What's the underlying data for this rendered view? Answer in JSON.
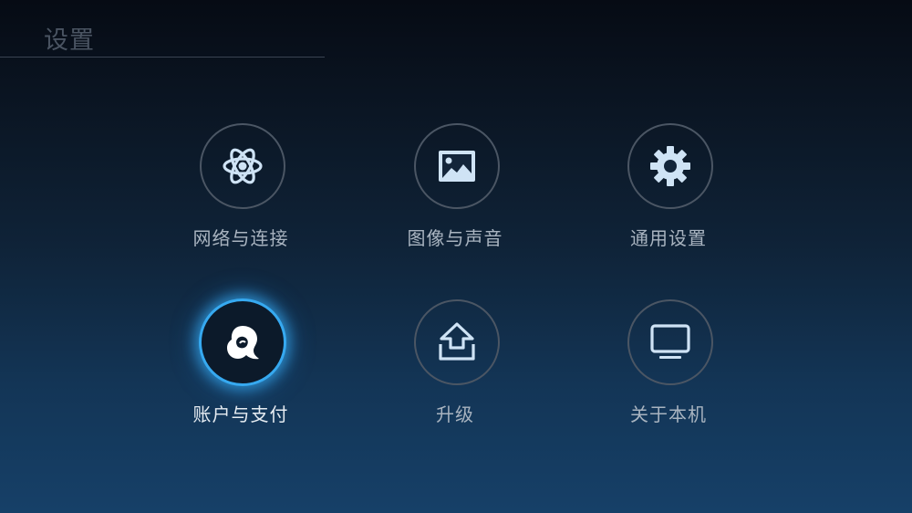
{
  "header": {
    "title": "设置"
  },
  "menu": {
    "items": [
      {
        "label": "网络与连接",
        "icon": "atom-icon",
        "selected": false
      },
      {
        "label": "图像与声音",
        "icon": "picture-icon",
        "selected": false
      },
      {
        "label": "通用设置",
        "icon": "gear-icon",
        "selected": false
      },
      {
        "label": "账户与支付",
        "icon": "account-icon",
        "selected": true
      },
      {
        "label": "升级",
        "icon": "upgrade-icon",
        "selected": false
      },
      {
        "label": "关于本机",
        "icon": "tv-icon",
        "selected": false
      }
    ]
  },
  "colors": {
    "accent": "#36a9f0",
    "icon_fill": "#cfe3f5",
    "ring": "#4b5664",
    "label": "#a9b4c0"
  }
}
